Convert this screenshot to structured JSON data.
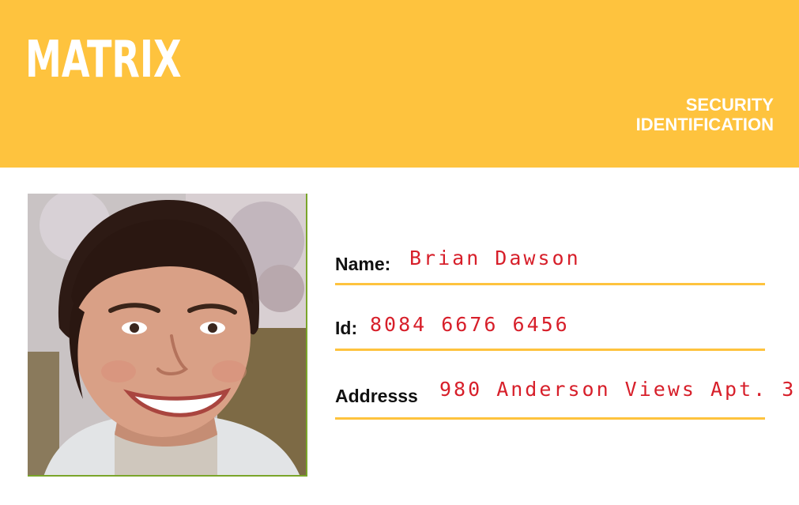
{
  "brand": {
    "name": "MATRIX",
    "color": "#fec33e"
  },
  "document": {
    "line1": "SECURITY",
    "line2": "IDENTIFICATION"
  },
  "photo": {
    "icon": "portrait-photo"
  },
  "fields": {
    "name_label": "Name:",
    "name_value": "Brian Dawson",
    "id_label": "Id:",
    "id_value": "8084 6676 6456",
    "address_label": "Addresss",
    "address_value": "980 Anderson Views Apt. 3"
  },
  "colors": {
    "value_text": "#d71f2a",
    "rule": "#fec33e"
  }
}
